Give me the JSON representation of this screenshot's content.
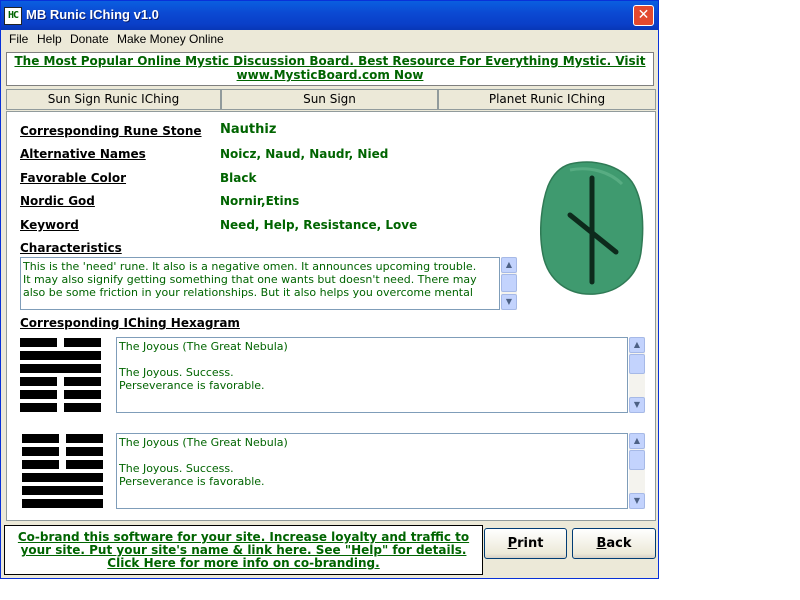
{
  "window": {
    "title": "MB Runic IChing v1.0",
    "icon_text": "HC",
    "close_glyph": "✕"
  },
  "menu": [
    "File",
    "Help",
    "Donate",
    "Make Money Online"
  ],
  "banner": {
    "line1": "The Most Popular Online Mystic Discussion Board. Best Resource For Everything Mystic. Visit",
    "line2": "www.MysticBoard.com Now"
  },
  "tabs": [
    {
      "label": "Sun Sign Runic IChing",
      "active": true
    },
    {
      "label": "Sun Sign",
      "active": false
    },
    {
      "label": "Planet Runic IChing",
      "active": false
    }
  ],
  "fields": {
    "rune_stone": {
      "label": "Corresponding Rune Stone",
      "value": "Nauthiz"
    },
    "alt_names": {
      "label": "Alternative Names",
      "value": "Noicz, Naud, Naudr, Nied"
    },
    "color": {
      "label": "Favorable Color",
      "value": "Black"
    },
    "god": {
      "label": "Nordic God",
      "value": "Nornir,Etins"
    },
    "keyword": {
      "label": "Keyword",
      "value": "Need, Help, Resistance, Love"
    }
  },
  "characteristics": {
    "label": "Characteristics",
    "line1": "This is the 'need' rune. It also is a negative omen. It announces upcoming trouble.",
    "line2": "It may also signify getting something that one wants but doesn't need. There may",
    "line3": "also be some friction in your relationships. But it also helps you overcome mental"
  },
  "hexagram_section": {
    "label": "Corresponding IChing Hexagram",
    "hex1": {
      "line1": "The Joyous (The Great Nebula)",
      "line2": "",
      "line3": "The Joyous. Success.",
      "line4": "Perseverance is favorable."
    },
    "hex2": {
      "line1": "The Joyous (The Great Nebula)",
      "line2": "",
      "line3": "The Joyous. Success.",
      "line4": "Perseverance is favorable."
    }
  },
  "cobrand": {
    "line1": "Co-brand this software for your site.  Increase loyalty and traffic to",
    "line2": "your site. Put your site's name &  link here. See \"Help\" for details.",
    "line3": "Click Here for more info on co-branding."
  },
  "buttons": {
    "print": {
      "accel": "P",
      "rest": "rint"
    },
    "back": {
      "accel": "B",
      "rest": "ack"
    }
  },
  "colors": {
    "accent_text": "#006400",
    "title_bar": "#0a4ad3",
    "rune_stone": "#3f9a6f"
  }
}
